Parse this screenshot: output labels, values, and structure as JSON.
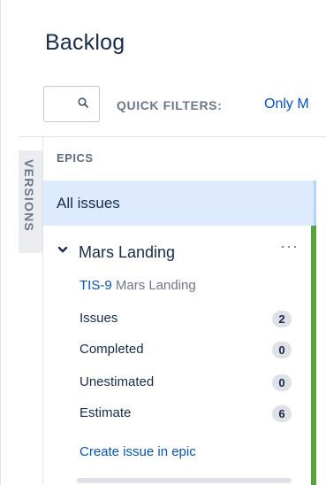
{
  "header": {
    "title": "Backlog"
  },
  "filters": {
    "search_icon": "search-icon",
    "quick_filters_label": "QUICK FILTERS:",
    "first_filter": "Only M"
  },
  "sidebar": {
    "versions_tab": "VERSIONS"
  },
  "epics": {
    "heading": "EPICS",
    "all_issues": "All issues",
    "items": [
      {
        "name": "Mars Landing",
        "key": "TIS-9",
        "summary": "Mars Landing",
        "more_label": "···",
        "stats": [
          {
            "label": "Issues",
            "value": "2"
          },
          {
            "label": "Completed",
            "value": "0"
          },
          {
            "label": "Unestimated",
            "value": "0"
          },
          {
            "label": "Estimate",
            "value": "6"
          }
        ],
        "create_link": "Create issue in epic",
        "progress": 0,
        "color": "#57a541"
      }
    ]
  },
  "colors": {
    "link": "#0052cc",
    "selected_bg": "#deebff",
    "epic_color": "#57a541"
  }
}
